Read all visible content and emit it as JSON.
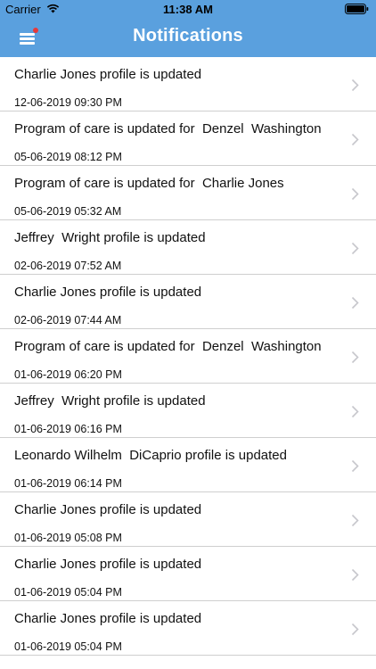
{
  "status_bar": {
    "carrier": "Carrier",
    "time": "11:38 AM"
  },
  "header": {
    "title": "Notifications",
    "background_color": "#5aa0de",
    "badge_color": "#e8393a"
  },
  "notifications": [
    {
      "title": "Charlie Jones profile is updated",
      "time": "12-06-2019 09:30 PM"
    },
    {
      "title": "Program of care is updated for  Denzel  Washington",
      "time": "05-06-2019 08:12 PM"
    },
    {
      "title": "Program of care is updated for  Charlie Jones",
      "time": "05-06-2019 05:32 AM"
    },
    {
      "title": "Jeffrey  Wright profile is updated",
      "time": "02-06-2019 07:52 AM"
    },
    {
      "title": "Charlie Jones profile is updated",
      "time": "02-06-2019 07:44 AM"
    },
    {
      "title": "Program of care is updated for  Denzel  Washington",
      "time": "01-06-2019 06:20 PM"
    },
    {
      "title": "Jeffrey  Wright profile is updated",
      "time": "01-06-2019 06:16 PM"
    },
    {
      "title": "Leonardo Wilhelm  DiCaprio profile is updated",
      "time": "01-06-2019 06:14 PM"
    },
    {
      "title": "Charlie Jones profile is updated",
      "time": "01-06-2019 05:08 PM"
    },
    {
      "title": "Charlie Jones profile is updated",
      "time": "01-06-2019 05:04 PM"
    },
    {
      "title": "Charlie Jones profile is updated",
      "time": "01-06-2019 05:04 PM"
    }
  ]
}
